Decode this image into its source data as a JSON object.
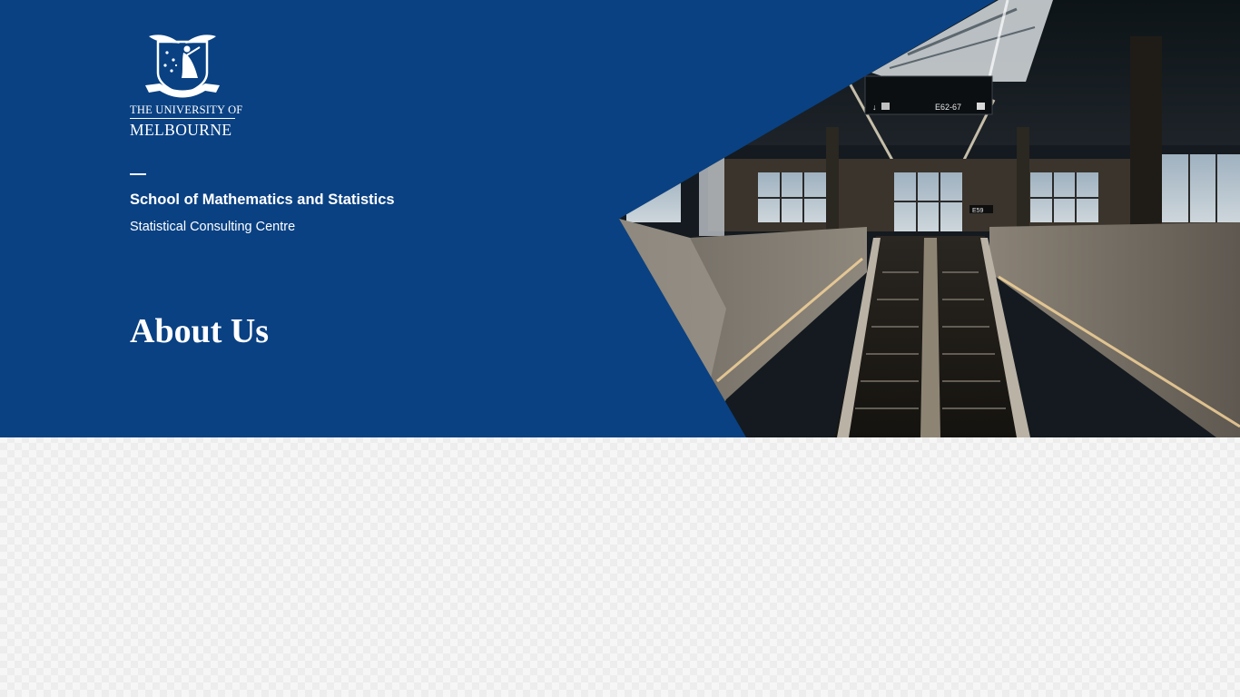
{
  "university": {
    "line1": "THE UNIVERSITY OF",
    "line2": "MELBOURNE",
    "motto": "POSTERA CRESCAM LAUDE"
  },
  "school": {
    "name": "School of Mathematics and Statistics",
    "unit": "Statistical Consulting Centre"
  },
  "page": {
    "title": "About Us"
  },
  "colors": {
    "brand_blue": "#094183",
    "page_background": "#f6f6f6"
  },
  "hero_image": {
    "alt": "Airport escalators"
  },
  "sign": {
    "gates_text": "E62-67",
    "gate_text": "E59"
  }
}
